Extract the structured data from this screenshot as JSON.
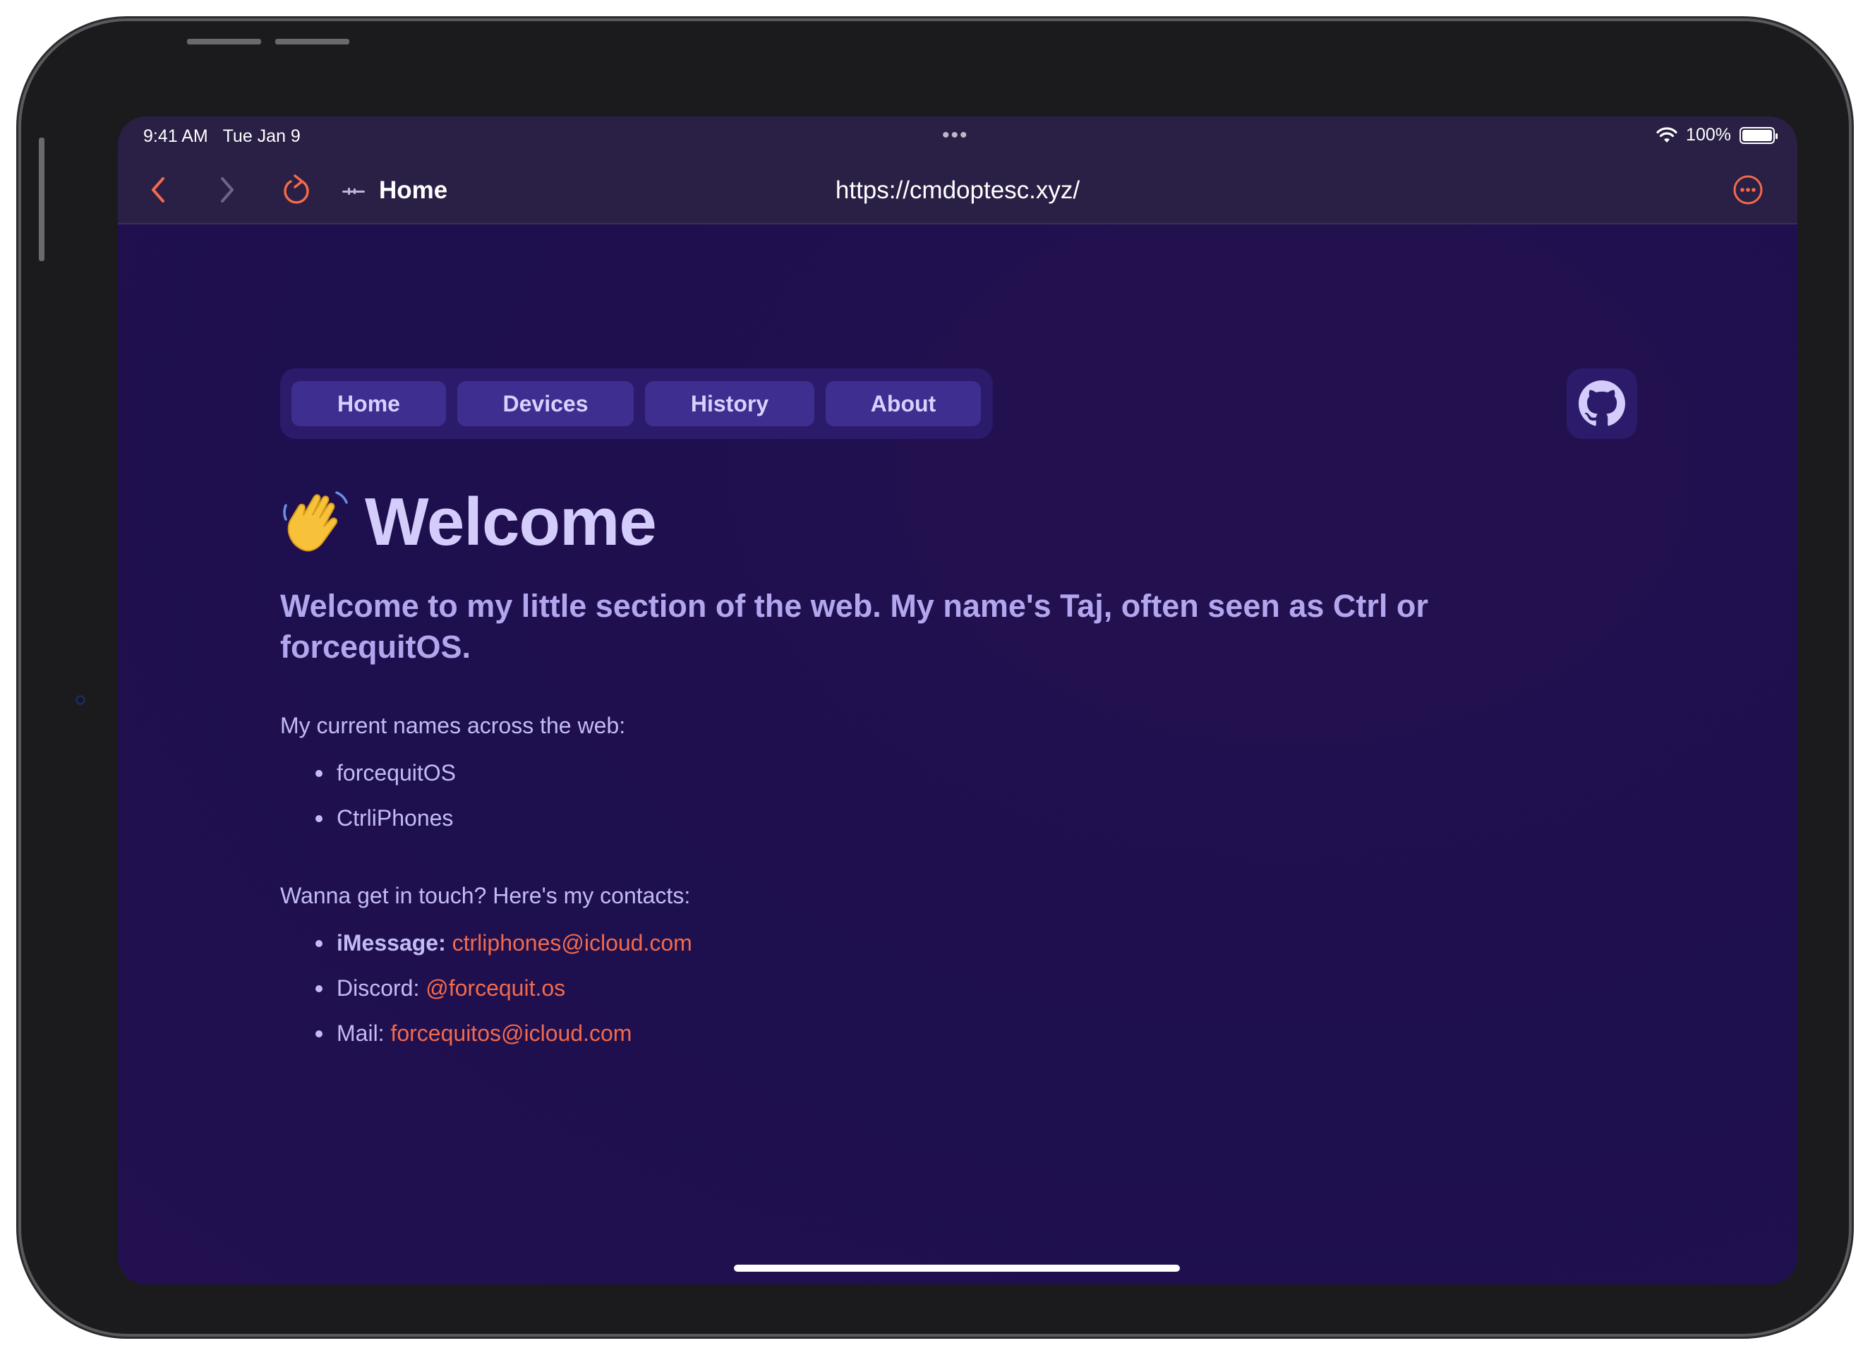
{
  "status": {
    "time": "9:41 AM",
    "date": "Tue Jan 9",
    "battery": "100%",
    "battery_level": 1.0
  },
  "toolbar": {
    "title": "Home",
    "url": "https://cmdoptesc.xyz/",
    "accent": "#f26a4b"
  },
  "nav": {
    "home": "Home",
    "devices": "Devices",
    "history": "History",
    "about": "About"
  },
  "hero": {
    "title": "Welcome"
  },
  "lead": "Welcome to my little section of the web. My name's Taj, often seen as Ctrl or forcequitOS.",
  "names": {
    "label": "My current names across the web:",
    "items": [
      "forcequitOS",
      "CtrliPhones"
    ]
  },
  "contacts": {
    "label": "Wanna get in touch? Here's my contacts:",
    "imessage_label": "iMessage:",
    "imessage_value": "ctrliphones@icloud.com",
    "discord_label": "Discord:",
    "discord_value": "@forcequit.os",
    "mail_label": "Mail:",
    "mail_value": "forcequitos@icloud.com"
  },
  "colors": {
    "background": "#1e0f4f",
    "nav_background": "#2c1a6b",
    "nav_button": "#3d2e8f",
    "link": "#f26a4b"
  }
}
